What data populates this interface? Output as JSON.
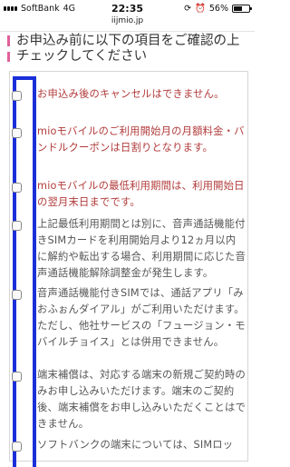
{
  "status": {
    "carrier": "SoftBank",
    "network": "4G",
    "time": "22:35",
    "battery": "56%",
    "battery_level": 0.56
  },
  "url": "iijmio.jp",
  "heading": "お申込み前に以下の項目をご確認の上チェックしてください",
  "items": [
    {
      "text": "お申込み後のキャンセルはできません。",
      "color": "#b23b3b"
    },
    {
      "text": "mioモバイルのご利用開始月の月額料金・バンドルクーポンは日割りとなります。",
      "color": "#b23b3b"
    },
    {
      "text": "mioモバイルの最低利用期間は、利用開始日の翌月末日までです。",
      "color": "#b23b3b"
    },
    {
      "text": "上記最低利用期間とは別に、音声通話機能付きSIMカードを利用開始月より12ヵ月以内に解約や転出する場合、利用期間に応じた音声通話機能解除調整金が発生します。",
      "color": "#555555"
    },
    {
      "text": "音声通話機能付きSIMでは、通話アプリ「みおふぉんダイアル」がご利用いただけます。ただし、他社サービスの「フュージョン・モバイルチョイス」とは併用できません。",
      "color": "#555555"
    },
    {
      "text": "端末補償は、対応する端末の新規ご契約時のみお申し込みいただけます。端末のご契約後、端末補償をお申し込みいただくことはできません。",
      "color": "#555555"
    },
    {
      "text": "ソフトバンクの端末については、SIMロッ",
      "color": "#555555"
    }
  ]
}
